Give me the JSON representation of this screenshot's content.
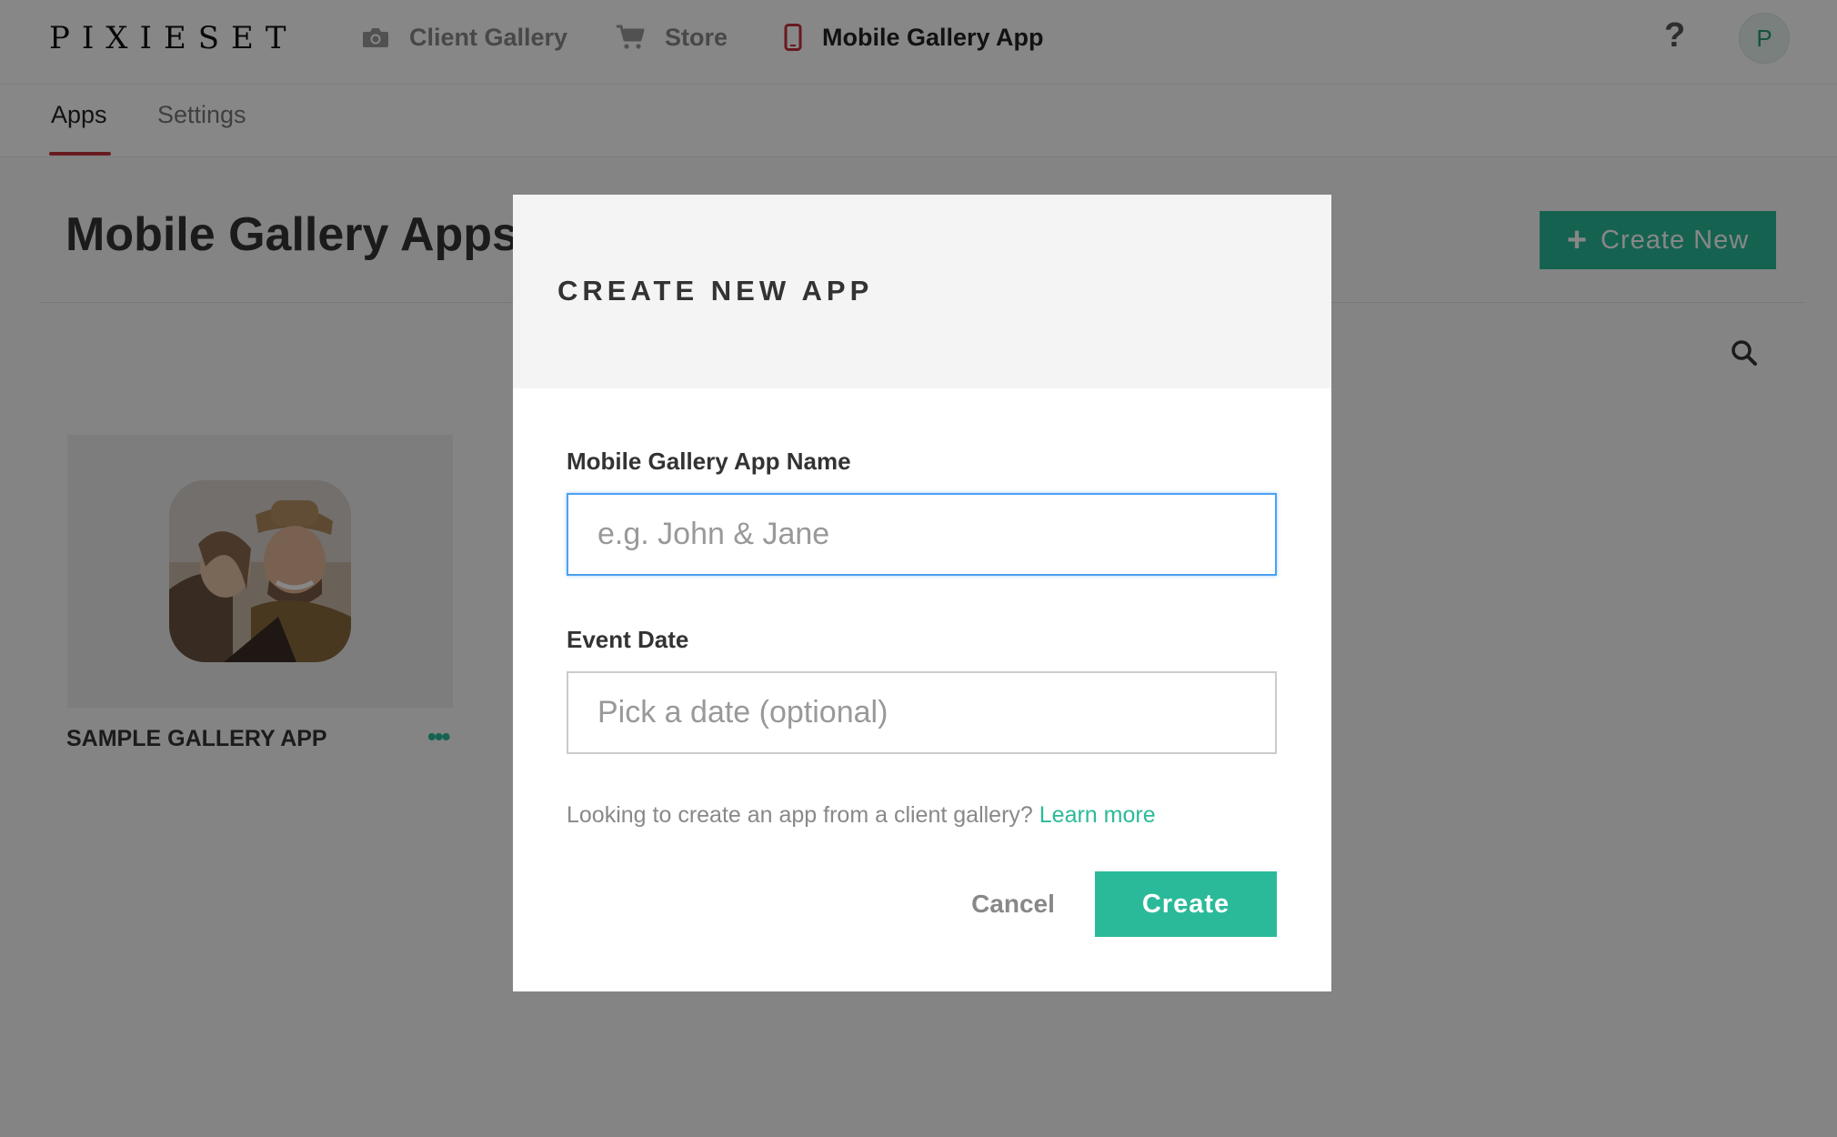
{
  "brand": {
    "logo": "PIXIESET"
  },
  "nav": {
    "items": [
      {
        "label": "Client Gallery",
        "icon": "camera-icon",
        "active": false
      },
      {
        "label": "Store",
        "icon": "cart-icon",
        "active": false
      },
      {
        "label": "Mobile Gallery App",
        "icon": "mobile-phone-icon",
        "active": true
      }
    ],
    "help": "?",
    "avatar_initial": "P"
  },
  "subnav": {
    "tabs": [
      {
        "label": "Apps",
        "active": true
      },
      {
        "label": "Settings",
        "active": false
      }
    ]
  },
  "page": {
    "title": "Mobile Gallery Apps",
    "create_new_label": "Create New",
    "search_icon": "search-icon"
  },
  "apps": [
    {
      "name": "SAMPLE GALLERY APP",
      "more": "•••"
    }
  ],
  "modal": {
    "title": "CREATE NEW APP",
    "name_label": "Mobile Gallery App Name",
    "name_value": "",
    "name_placeholder": "e.g. John & Jane",
    "date_label": "Event Date",
    "date_value": "",
    "date_placeholder": "Pick a date (optional)",
    "hint": "Looking to create an app from a client gallery?",
    "hint_link": "Learn more",
    "cancel_label": "Cancel",
    "create_label": "Create"
  },
  "colors": {
    "accent": "#2bba99",
    "active_tab_underline": "#c4323a",
    "mobile_icon": "#c4323a",
    "focus_border": "#4ea0f0"
  }
}
